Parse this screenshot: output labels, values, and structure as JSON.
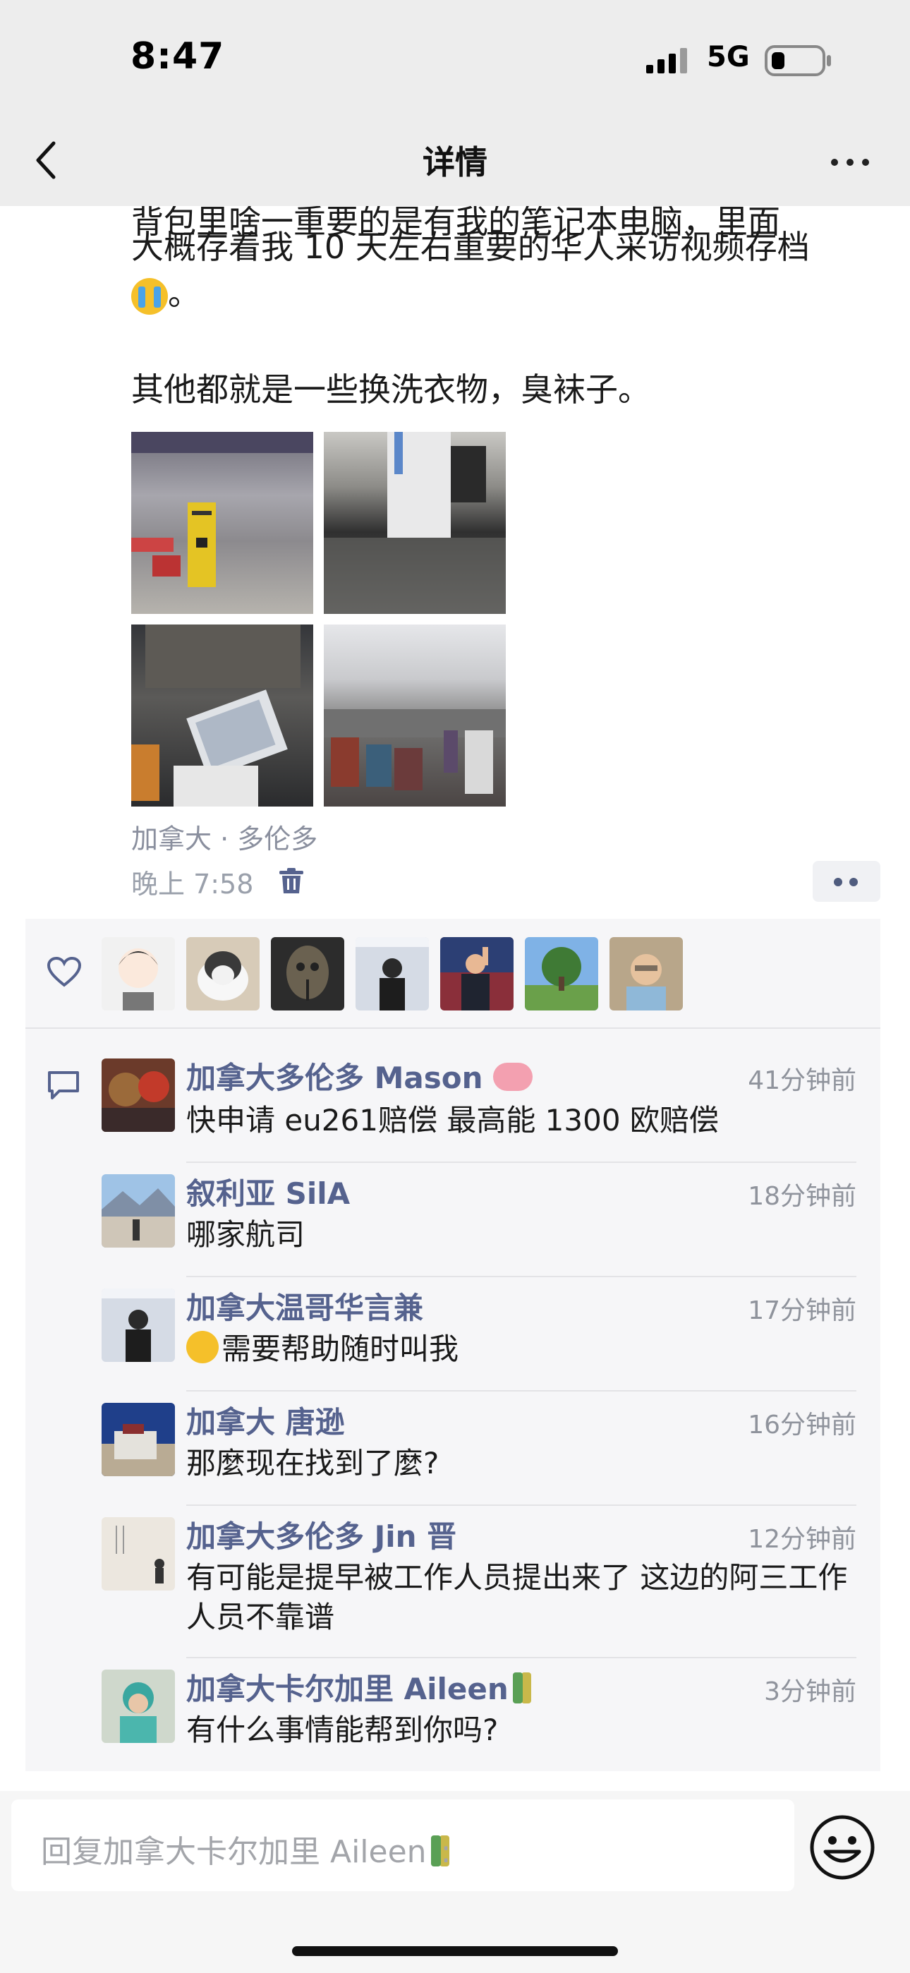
{
  "status_bar": {
    "time": "8:47",
    "network": "5G"
  },
  "nav": {
    "title": "详情"
  },
  "post": {
    "partial_line": "背包里啥一重要的是有我的笔记本电脑，里面",
    "line2": "大概存着我 10 天左右重要的华人采访视频存档",
    "line3_suffix": "。",
    "line4": "其他都就是一些换洗衣物，臭袜子。",
    "location": "加拿大 · 多伦多",
    "time": "晚上 7:58"
  },
  "comments": [
    {
      "name": "加拿大多伦多 Mason",
      "time": "41分钟前",
      "text": "快申请 eu261赔偿 最高能 1300 欧赔偿"
    },
    {
      "name": "叙利亚 SilA",
      "time": "18分钟前",
      "text": "哪家航司"
    },
    {
      "name": "加拿大温哥华言兼",
      "time": "17分钟前",
      "text": "需要帮助随时叫我"
    },
    {
      "name": "加拿大 唐逊",
      "time": "16分钟前",
      "text": "那麼现在找到了麼?"
    },
    {
      "name": "加拿大多伦多 Jin 晋",
      "time": "12分钟前",
      "text": "有可能是提早被工作人员提出来了 这边的阿三工作人员不靠谱"
    },
    {
      "name": "加拿大卡尔加里 Aileen",
      "time": "3分钟前",
      "text": "有什么事情能帮到你吗?"
    }
  ],
  "reply": {
    "placeholder": "回复加拿大卡尔加里 Aileen",
    "colon": ":"
  },
  "colors": {
    "name_blue": "#55628e",
    "panel_bg": "#f6f6f8",
    "nav_bg": "#ededed"
  }
}
